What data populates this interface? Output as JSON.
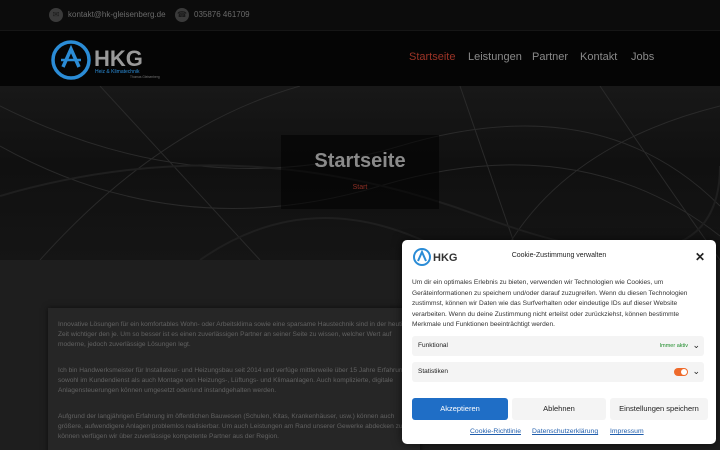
{
  "topbar": {
    "email": "kontakt@hk-gleisenberg.de",
    "phone": "035876 461709",
    "email_icon": "mail-icon",
    "phone_icon": "phone-icon"
  },
  "brand": {
    "name": "HKG",
    "tagline": "Heiz & Klimatechnik",
    "sub": "Thomas Gleisenberg",
    "accent": "#2b8cd6"
  },
  "nav": {
    "items": [
      "Startseite",
      "Leistungen",
      "Partner",
      "Kontakt",
      "Jobs"
    ],
    "active_color": "#9c3427"
  },
  "hero": {
    "title": "Startseite",
    "breadcrumb": "Start"
  },
  "content": {
    "p1": "Innovative Lösungen für ein komfortables Wohn- oder Arbeitsklima sowie eine sparsame Haustechnik sind in der heutigen Zeit wichtiger den je. Um so besser ist es einen zuverlässigen Partner an seiner Seite zu wissen, welcher Wert auf moderne, jedoch zuverlässige Lösungen legt.",
    "p2": "Ich bin Handwerksmeister für Installateur- und Heizungsbau seit 2014 und verfüge mittlerweile über 15 Jahre Erfahrung sowohl im Kundendienst als auch Montage von Heizungs-, Lüftungs- und Klimaanlagen. Auch komplizierte, digitale Anlagensteuerungen können umgesetzt oder/und instandgehalten werden.",
    "p3": "Aufgrund der langjährigen Erfahrung im öffentlichen Bauwesen (Schulen, Kitas, Krankenhäuser, usw.) können auch größere, aufwendigere Anlagen problemlos realisierbar. Um auch Leistungen am Rand unserer Gewerke abdecken zu können verfügen wir über zuverlässige kompetente Partner aus der Region."
  },
  "cookie": {
    "title": "Cookie-Zustimmung verwalten",
    "message": "Um dir ein optimales Erlebnis zu bieten, verwenden wir Technologien wie Cookies, um Geräteinformationen zu speichern und/oder darauf zuzugreifen. Wenn du diesen Technologien zustimmst, können wir Daten wie das Surfverhalten oder eindeutige IDs auf dieser Website verarbeiten. Wenn du deine Zustimmung nicht erteilst oder zurückziehst, können bestimmte Merkmale und Funktionen beeinträchtigt werden.",
    "rows": [
      {
        "label": "Funktional",
        "status": "Immer aktiv"
      },
      {
        "label": "Statistiken",
        "status": ""
      }
    ],
    "buttons": {
      "accept": "Akzeptieren",
      "deny": "Ablehnen",
      "settings": "Einstellungen speichern"
    },
    "links": [
      "Cookie-Richtlinie",
      "Datenschutzerklärung",
      "Impressum"
    ],
    "primary_color": "#1f6ec6",
    "toggle_color": "#ee6a2b"
  }
}
